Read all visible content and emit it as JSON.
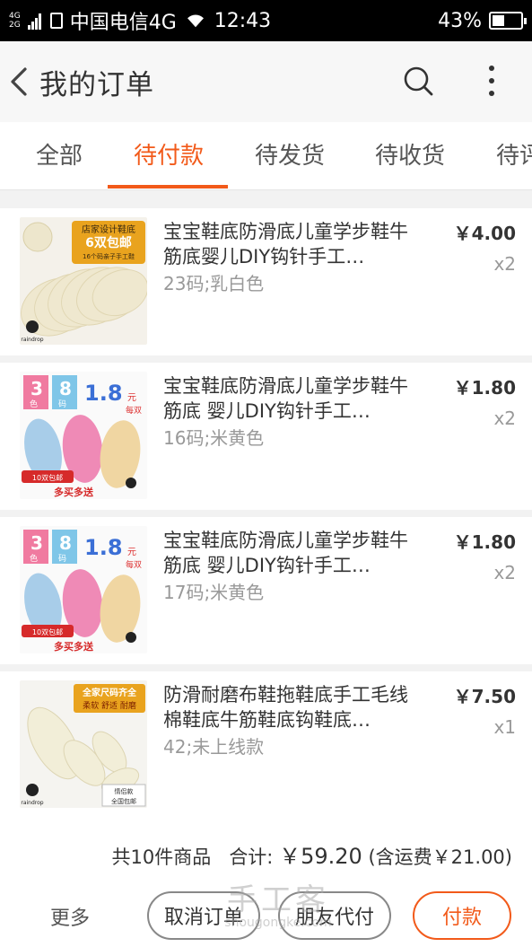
{
  "status_bar": {
    "network_top": "4G",
    "network_bottom": "2G",
    "carrier": "中国电信4G",
    "time": "12:43",
    "battery": "43%",
    "battery_level": 0.43
  },
  "header": {
    "title": "我的订单",
    "back_icon": "chevron-left-icon",
    "search_icon": "search-icon",
    "more_icon": "more-vertical-icon"
  },
  "tabs": [
    {
      "label": "全部",
      "active": false
    },
    {
      "label": "待付款",
      "active": true
    },
    {
      "label": "待发货",
      "active": false
    },
    {
      "label": "待收货",
      "active": false
    },
    {
      "label": "待评",
      "active": false
    }
  ],
  "items": [
    {
      "title": "宝宝鞋底防滑底儿童学步鞋牛筋底婴儿DIY钩针手工…",
      "sku": "23码;乳白色",
      "price": "￥4.00",
      "qty": "x2",
      "image": {
        "badge_line1": "店家设计鞋底",
        "badge_line2": "6双包邮",
        "badge_line3": "16个码亲子手工鞋",
        "brand": "raindrop"
      }
    },
    {
      "title": "宝宝鞋底防滑底儿童学步鞋牛筋底 婴儿DIY钩针手工…",
      "sku": "16码;米黄色",
      "price": "￥1.80",
      "qty": "x2",
      "image": {
        "n1": "3",
        "l1": "色",
        "n2": "8",
        "l2": "码",
        "price": "1.8",
        "unit": "元",
        "per": "每双",
        "promo1": "10双包邮",
        "promo2": "多买多送"
      }
    },
    {
      "title": "宝宝鞋底防滑底儿童学步鞋牛筋底 婴儿DIY钩针手工…",
      "sku": "17码;米黄色",
      "price": "￥1.80",
      "qty": "x2",
      "image": {
        "n1": "3",
        "l1": "色",
        "n2": "8",
        "l2": "码",
        "price": "1.8",
        "unit": "元",
        "per": "每双",
        "promo1": "10双包邮",
        "promo2": "多买多送"
      }
    },
    {
      "title": "防滑耐磨布鞋拖鞋底手工毛线棉鞋底牛筋鞋底钩鞋底…",
      "sku": "42;未上线款",
      "price": "￥7.50",
      "qty": "x1",
      "image": {
        "badge_line1": "全家尺码齐全",
        "badge_line2": "柔软 舒适 耐磨",
        "corner1": "情侣款",
        "corner2": "全国包邮",
        "brand": "raindrop"
      }
    }
  ],
  "summary": {
    "count_text": "共10件商品",
    "total_label": "合计: ",
    "total": "￥59.20",
    "shipping": "(含运费￥21.00)"
  },
  "footer": {
    "more": "更多",
    "cancel": "取消订单",
    "friend_pay": "朋友代付",
    "pay": "付款"
  },
  "watermark": {
    "main": "手工客",
    "url": "shougongke.com"
  },
  "colors": {
    "accent": "#f25a1a",
    "bg": "#f2f2f2"
  }
}
